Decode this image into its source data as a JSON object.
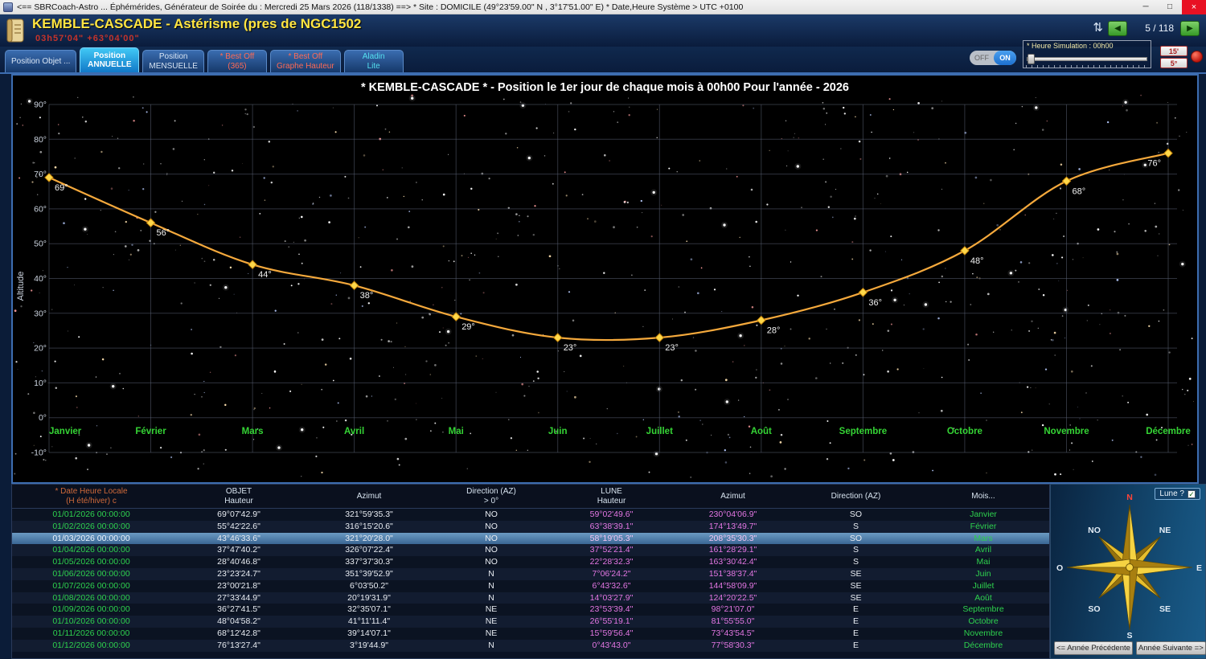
{
  "titlebar": {
    "title": "<== SBRCoach-Astro ... Éphémérides, Générateur de Soirée du : Mercredi 25 Mars 2026  (118/1338) ==>  * Site : DOMICILE (49°23'59.00\" N , 3°17'51.00\" E)   * Date,Heure Système > UTC +0100"
  },
  "icons": {
    "minimize": "─",
    "maximize": "□",
    "close": "×",
    "prev": "◀",
    "next": "▶",
    "swap": "⇅",
    "check": "✓"
  },
  "header": {
    "title": "KEMBLE-CASCADE - Astérisme (pres de NGC1502",
    "coordinates": "03h57'04\"   +63°04'00\"",
    "page_indicator": "5 / 118"
  },
  "tabs": [
    {
      "line1": "Position Objet ...",
      "line2": ""
    },
    {
      "line1": "Position",
      "line2": "ANNUELLE"
    },
    {
      "line1": "Position",
      "line2": "MENSUELLE"
    },
    {
      "line1": "* Best Off",
      "line2": "(365)"
    },
    {
      "line1": "* Best Off",
      "line2": "Graphe Hauteur"
    },
    {
      "line1": "Aladin",
      "line2": "Lite"
    }
  ],
  "controls": {
    "off_label": "OFF",
    "on_label": "ON",
    "sim_label": "* Heure Simulation : 00h00",
    "btn_15": "15'",
    "btn_5": "5°"
  },
  "chart_data": {
    "type": "line",
    "title": "* KEMBLE-CASCADE * - Position le 1er jour de chaque mois à 00h00 Pour l'année - 2026",
    "ylabel": "Altitude",
    "categories": [
      "Janvier",
      "Février",
      "Mars",
      "Avril",
      "Mai",
      "Juin",
      "Juillet",
      "Août",
      "Septembre",
      "Octobre",
      "Novembre",
      "Décembre"
    ],
    "values": [
      69,
      56,
      44,
      38,
      29,
      23,
      23,
      28,
      36,
      48,
      68,
      76
    ],
    "point_labels": [
      "69°",
      "56°",
      "44°",
      "38°",
      "29°",
      "23°",
      "23°",
      "28°",
      "36°",
      "48°",
      "68°",
      "76°"
    ],
    "ylim": [
      -10,
      90
    ],
    "y_tick_step": 10,
    "grid": true,
    "line_color": "#f5a93c",
    "marker_color": "#ffd84a",
    "month_label_color": "#35d435"
  },
  "table": {
    "headers": {
      "date_line1": "* Date Heure Locale",
      "date_line2": "(H été/hiver) c",
      "objet_line1": "OBJET",
      "objet_line2": "Hauteur",
      "azimut1": "Azimut",
      "dir1_line1": "Direction (AZ)",
      "dir1_line2": "> 0°",
      "lune_line1": "LUNE",
      "lune_line2": "Hauteur",
      "azimut2": "Azimut",
      "dir2": "Direction (AZ)",
      "mois": "Mois..."
    },
    "rows": [
      {
        "date": "01/01/2026 00:00:00",
        "objet_hauteur": "69°07'42.9\"",
        "objet_azimut": "321°59'35.3\"",
        "objet_dir": "NO",
        "lune_hauteur": "59°02'49.6\"",
        "lune_azimut": "230°04'06.9\"",
        "lune_dir": "SO",
        "mois": "Janvier",
        "selected": false
      },
      {
        "date": "01/02/2026 00:00:00",
        "objet_hauteur": "55°42'22.6\"",
        "objet_azimut": "316°15'20.6\"",
        "objet_dir": "NO",
        "lune_hauteur": "63°38'39.1\"",
        "lune_azimut": "174°13'49.7\"",
        "lune_dir": "S",
        "mois": "Février",
        "selected": false
      },
      {
        "date": "01/03/2026 00:00:00",
        "objet_hauteur": "43°46'33.6\"",
        "objet_azimut": "321°20'28.0\"",
        "objet_dir": "NO",
        "lune_hauteur": "58°19'05.3\"",
        "lune_azimut": "208°35'30.3\"",
        "lune_dir": "SO",
        "mois": "Mars",
        "selected": true
      },
      {
        "date": "01/04/2026 00:00:00",
        "objet_hauteur": "37°47'40.2\"",
        "objet_azimut": "326°07'22.4\"",
        "objet_dir": "NO",
        "lune_hauteur": "37°52'21.4\"",
        "lune_azimut": "161°28'29.1\"",
        "lune_dir": "S",
        "mois": "Avril",
        "selected": false
      },
      {
        "date": "01/05/2026 00:00:00",
        "objet_hauteur": "28°40'46.8\"",
        "objet_azimut": "337°37'30.3\"",
        "objet_dir": "NO",
        "lune_hauteur": "22°28'32.3\"",
        "lune_azimut": "163°30'42.4\"",
        "lune_dir": "S",
        "mois": "Mai",
        "selected": false
      },
      {
        "date": "01/06/2026 00:00:00",
        "objet_hauteur": "23°23'24.7\"",
        "objet_azimut": "351°39'52.9\"",
        "objet_dir": "N",
        "lune_hauteur": "7°06'24.2\"",
        "lune_azimut": "151°38'37.4\"",
        "lune_dir": "SE",
        "mois": "Juin",
        "selected": false
      },
      {
        "date": "01/07/2026 00:00:00",
        "objet_hauteur": "23°00'21.8\"",
        "objet_azimut": "6°03'50.2\"",
        "objet_dir": "N",
        "lune_hauteur": "6°43'32.6\"",
        "lune_azimut": "144°58'09.9\"",
        "lune_dir": "SE",
        "mois": "Juillet",
        "selected": false
      },
      {
        "date": "01/08/2026 00:00:00",
        "objet_hauteur": "27°33'44.9\"",
        "objet_azimut": "20°19'31.9\"",
        "objet_dir": "N",
        "lune_hauteur": "14°03'27.9\"",
        "lune_azimut": "124°20'22.5\"",
        "lune_dir": "SE",
        "mois": "Août",
        "selected": false
      },
      {
        "date": "01/09/2026 00:00:00",
        "objet_hauteur": "36°27'41.5\"",
        "objet_azimut": "32°35'07.1\"",
        "objet_dir": "NE",
        "lune_hauteur": "23°53'39.4\"",
        "lune_azimut": "98°21'07.0\"",
        "lune_dir": "E",
        "mois": "Septembre",
        "selected": false
      },
      {
        "date": "01/10/2026 00:00:00",
        "objet_hauteur": "48°04'58.2\"",
        "objet_azimut": "41°11'11.4\"",
        "objet_dir": "NE",
        "lune_hauteur": "26°55'19.1\"",
        "lune_azimut": "81°55'55.0\"",
        "lune_dir": "E",
        "mois": "Octobre",
        "selected": false
      },
      {
        "date": "01/11/2026 00:00:00",
        "objet_hauteur": "68°12'42.8\"",
        "objet_azimut": "39°14'07.1\"",
        "objet_dir": "NE",
        "lune_hauteur": "15°59'56.4\"",
        "lune_azimut": "73°43'54.5\"",
        "lune_dir": "E",
        "mois": "Novembre",
        "selected": false
      },
      {
        "date": "01/12/2026 00:00:00",
        "objet_hauteur": "76°13'27.4\"",
        "objet_azimut": "3°19'44.9\"",
        "objet_dir": "N",
        "lune_hauteur": "0°43'43.0\"",
        "lune_azimut": "77°58'30.3\"",
        "lune_dir": "E",
        "mois": "Décembre",
        "selected": false
      }
    ]
  },
  "compass": {
    "lune_label": "Lune ?",
    "directions": [
      "N",
      "NE",
      "E",
      "SE",
      "S",
      "SO",
      "O",
      "NO"
    ]
  },
  "footer": {
    "prev_year": "<= Année Précédente",
    "next_year": "Année Suivante =>"
  }
}
